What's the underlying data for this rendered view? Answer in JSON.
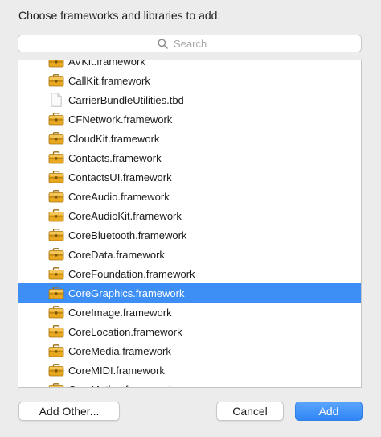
{
  "dialog": {
    "title": "Choose frameworks and libraries to add:"
  },
  "search": {
    "placeholder": "Search",
    "value": ""
  },
  "list": {
    "items": [
      {
        "label": "AVKit.framework",
        "type": "framework"
      },
      {
        "label": "CallKit.framework",
        "type": "framework"
      },
      {
        "label": "CarrierBundleUtilities.tbd",
        "type": "file"
      },
      {
        "label": "CFNetwork.framework",
        "type": "framework"
      },
      {
        "label": "CloudKit.framework",
        "type": "framework"
      },
      {
        "label": "Contacts.framework",
        "type": "framework"
      },
      {
        "label": "ContactsUI.framework",
        "type": "framework"
      },
      {
        "label": "CoreAudio.framework",
        "type": "framework"
      },
      {
        "label": "CoreAudioKit.framework",
        "type": "framework"
      },
      {
        "label": "CoreBluetooth.framework",
        "type": "framework"
      },
      {
        "label": "CoreData.framework",
        "type": "framework"
      },
      {
        "label": "CoreFoundation.framework",
        "type": "framework"
      },
      {
        "label": "CoreGraphics.framework",
        "type": "framework",
        "selected": true
      },
      {
        "label": "CoreImage.framework",
        "type": "framework"
      },
      {
        "label": "CoreLocation.framework",
        "type": "framework"
      },
      {
        "label": "CoreMedia.framework",
        "type": "framework"
      },
      {
        "label": "CoreMIDI.framework",
        "type": "framework"
      },
      {
        "label": "CoreMotion.framework",
        "type": "framework"
      }
    ]
  },
  "buttons": {
    "add_other": "Add Other...",
    "cancel": "Cancel",
    "add": "Add"
  },
  "colors": {
    "selection": "#3d8ef5",
    "toolbox_body": "#e5a623",
    "primary_button": "#2f86f6"
  }
}
